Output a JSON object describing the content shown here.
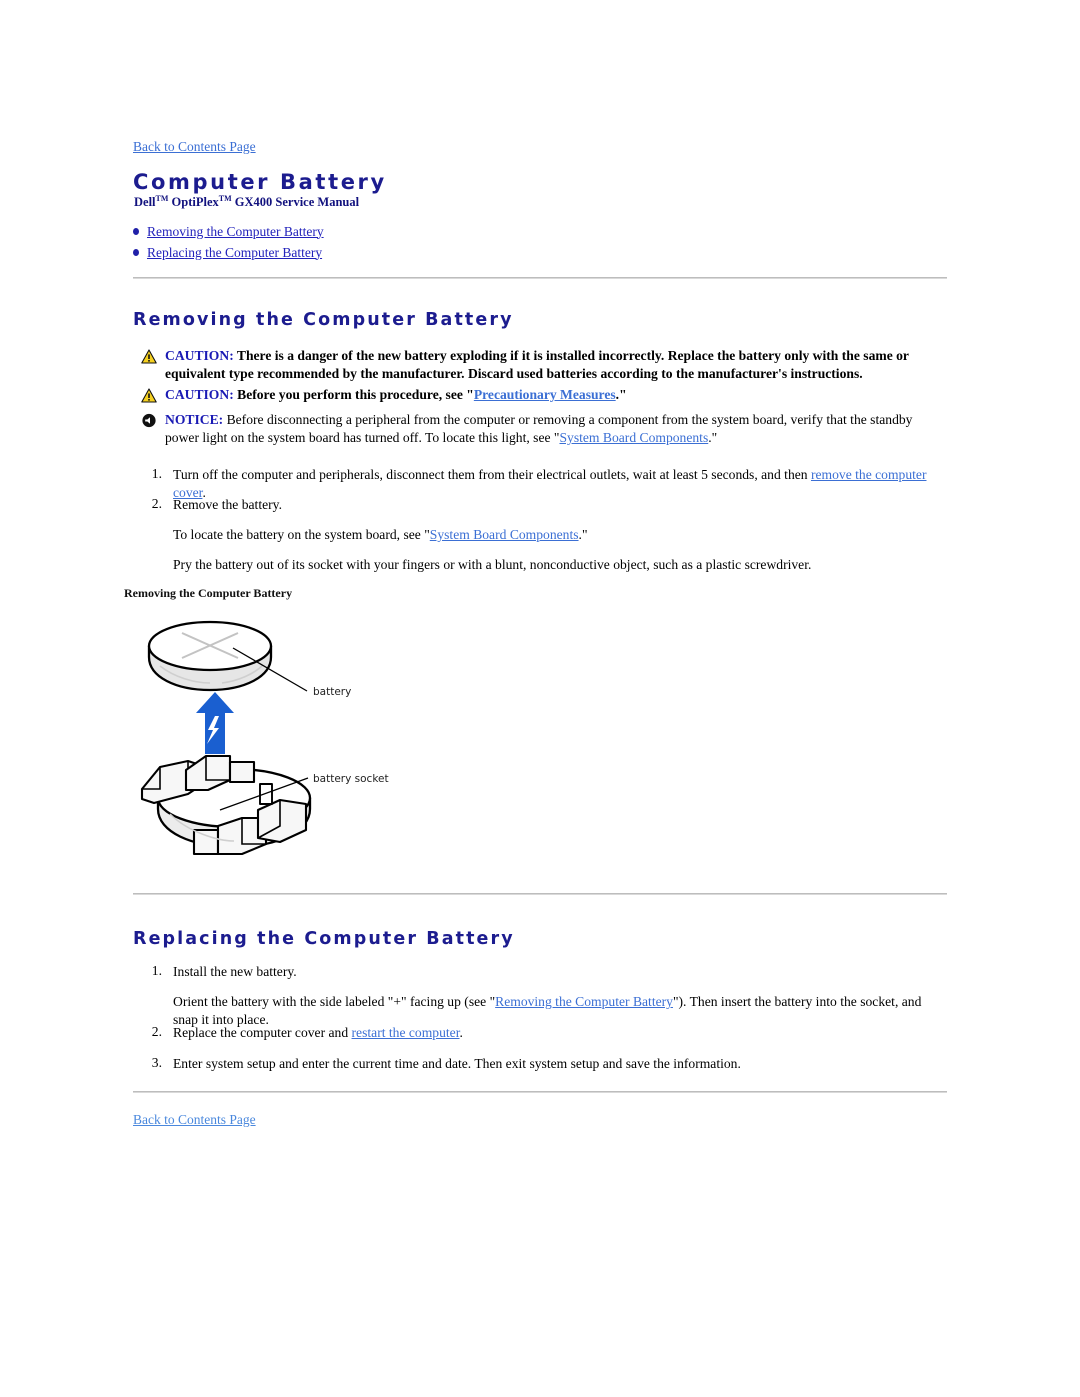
{
  "nav": {
    "back_to_contents_top": "Back to Contents Page",
    "back_to_contents_bottom": "Back to Contents Page"
  },
  "header": {
    "title": "Computer Battery",
    "subtitle_prefix": "Dell",
    "subtitle_tm1": "TM",
    "subtitle_mid": " OptiPlex",
    "subtitle_tm2": "TM",
    "subtitle_suffix": " GX400 Service Manual"
  },
  "toc": {
    "items": [
      {
        "label": "Removing the Computer Battery"
      },
      {
        "label": "Replacing the Computer Battery"
      }
    ]
  },
  "sections": {
    "removing": {
      "heading": "Removing the Computer Battery",
      "admonitions": [
        {
          "type": "caution",
          "icon": "warning-triangle-icon",
          "label": "CAUTION:",
          "text": " There is a danger of the new battery exploding if it is installed incorrectly. Replace the battery only with the same or equivalent type recommended by the manufacturer. Discard used batteries according to the manufacturer's instructions."
        },
        {
          "type": "caution",
          "icon": "warning-triangle-icon",
          "label": "CAUTION:",
          "text_before": " Before you perform this procedure, see \"",
          "link": "Precautionary Measures",
          "text_after": ".\""
        },
        {
          "type": "notice",
          "icon": "notice-circle-icon",
          "label": "NOTICE:",
          "text_before": " Before disconnecting a peripheral from the computer or removing a component from the system board, verify that the standby power light on the system board has turned off. To locate this light, see \"",
          "link": "System Board Components",
          "text_after": ".\""
        }
      ],
      "steps": [
        {
          "num": "1.",
          "text_before": "Turn off the computer and peripherals, disconnect them from their electrical outlets, wait at least 5 seconds, and then ",
          "link": "remove the computer cover",
          "text_after": "."
        },
        {
          "num": "2.",
          "text": "Remove the battery."
        }
      ],
      "substeps": [
        {
          "text_before": "To locate the battery on the system board, see \"",
          "link": "System Board Components",
          "text_after": ".\""
        },
        {
          "text": "Pry the battery out of its socket with your fingers or with a blunt, nonconductive object, such as a plastic screwdriver."
        }
      ],
      "figure": {
        "caption": "Removing the Computer Battery",
        "labels": {
          "battery": "battery",
          "battery_socket": "battery socket"
        },
        "arrow_color": "#1a5fd0"
      }
    },
    "replacing": {
      "heading": "Replacing the Computer Battery",
      "steps": [
        {
          "num": "1.",
          "text": "Install the new battery."
        },
        {
          "num": "2.",
          "text_before": "Replace the computer cover and ",
          "link": "restart the computer",
          "text_after": "."
        },
        {
          "num": "3.",
          "text": "Enter system setup and enter the current time and date. Then exit system setup and save the information."
        }
      ],
      "substeps": [
        {
          "text_before": "Orient the battery with the side labeled \"+\" facing up (see \"",
          "link": "Removing the Computer Battery",
          "text_after": "\"). Then insert the battery into the socket, and snap it into place."
        }
      ]
    }
  },
  "colors": {
    "heading_blue": "#1c1c8f",
    "link_blue": "#3b6fd4",
    "toc_link_blue": "#2222bb",
    "label_blue": "#1a1ab4",
    "caution_yellow": "#f5d020",
    "rule_gray": "#d9d9d9"
  }
}
